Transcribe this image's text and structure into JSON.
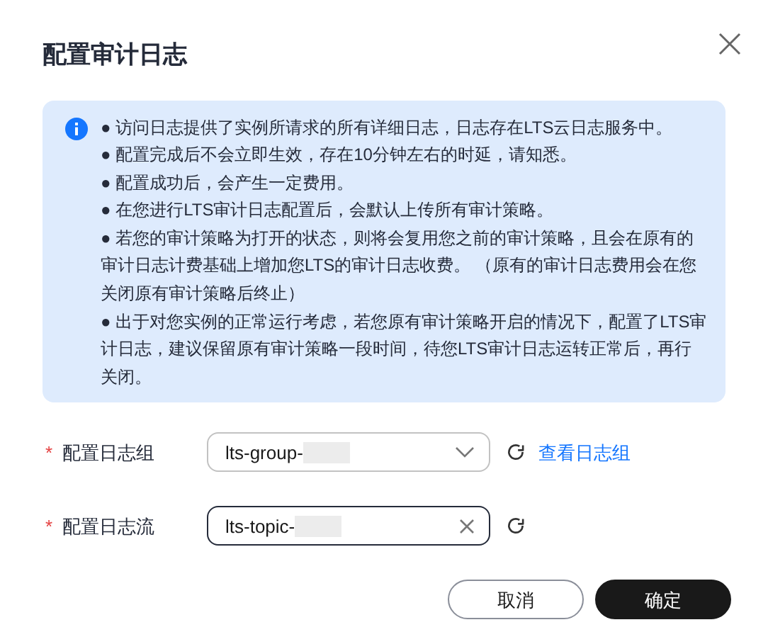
{
  "dialog": {
    "title": "配置审计日志"
  },
  "notice": {
    "items": [
      "● 访问日志提供了实例所请求的所有详细日志，日志存在LTS云日志服务中。",
      "● 配置完成后不会立即生效，存在10分钟左右的时延，请知悉。",
      "● 配置成功后，会产生一定费用。",
      "● 在您进行LTS审计日志配置后，会默认上传所有审计策略。",
      "● 若您的审计策略为打开的状态，则将会复用您之前的审计策略，且会在原有的审计日志计费基础上增加您LTS的审计日志收费。 （原有的审计日志费用会在您关闭原有审计策略后终止）",
      "● 出于对您实例的正常运行考虑，若您原有审计策略开启的情况下，配置了LTS审计日志，建议保留原有审计策略一段时间，待您LTS审计日志运转正常后，再行关闭。"
    ]
  },
  "form": [
    {
      "kind": "select",
      "required_mark": "*",
      "label": "配置日志组",
      "value": "lts-group-",
      "link": "查看日志组",
      "focused": false
    },
    {
      "kind": "input",
      "required_mark": "*",
      "label": "配置日志流",
      "value": "lts-topic-",
      "focused": true
    }
  ],
  "buttons": [
    {
      "label": "取消",
      "primary": false
    },
    {
      "label": "确定",
      "primary": true
    }
  ]
}
